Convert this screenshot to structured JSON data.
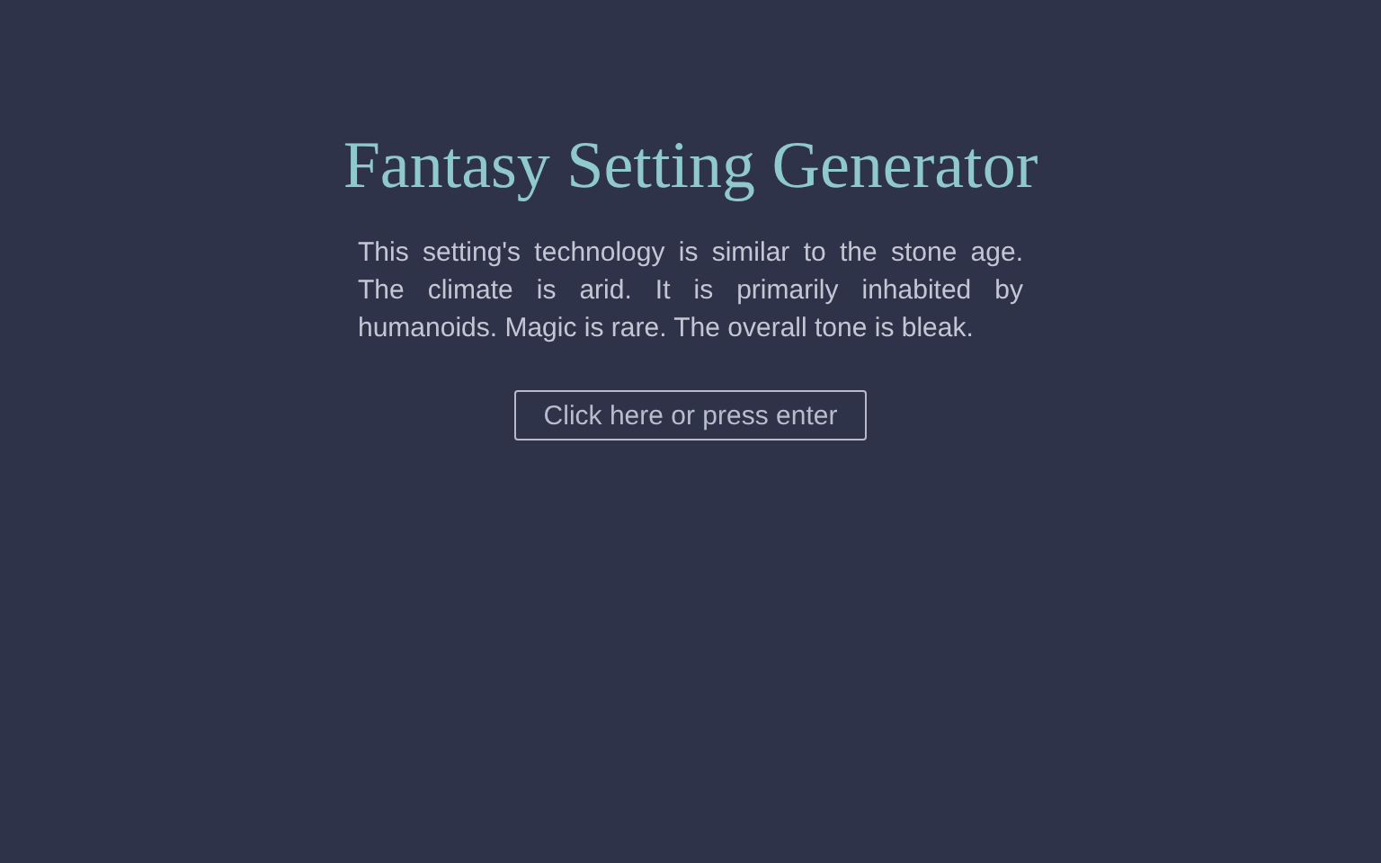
{
  "title": "Fantasy Setting Generator",
  "description": "This setting's technology is similar to the stone age. The climate is arid. It is primarily inhabited by humanoids. Magic is rare. The overall tone is bleak.",
  "button": "Click here or press enter"
}
